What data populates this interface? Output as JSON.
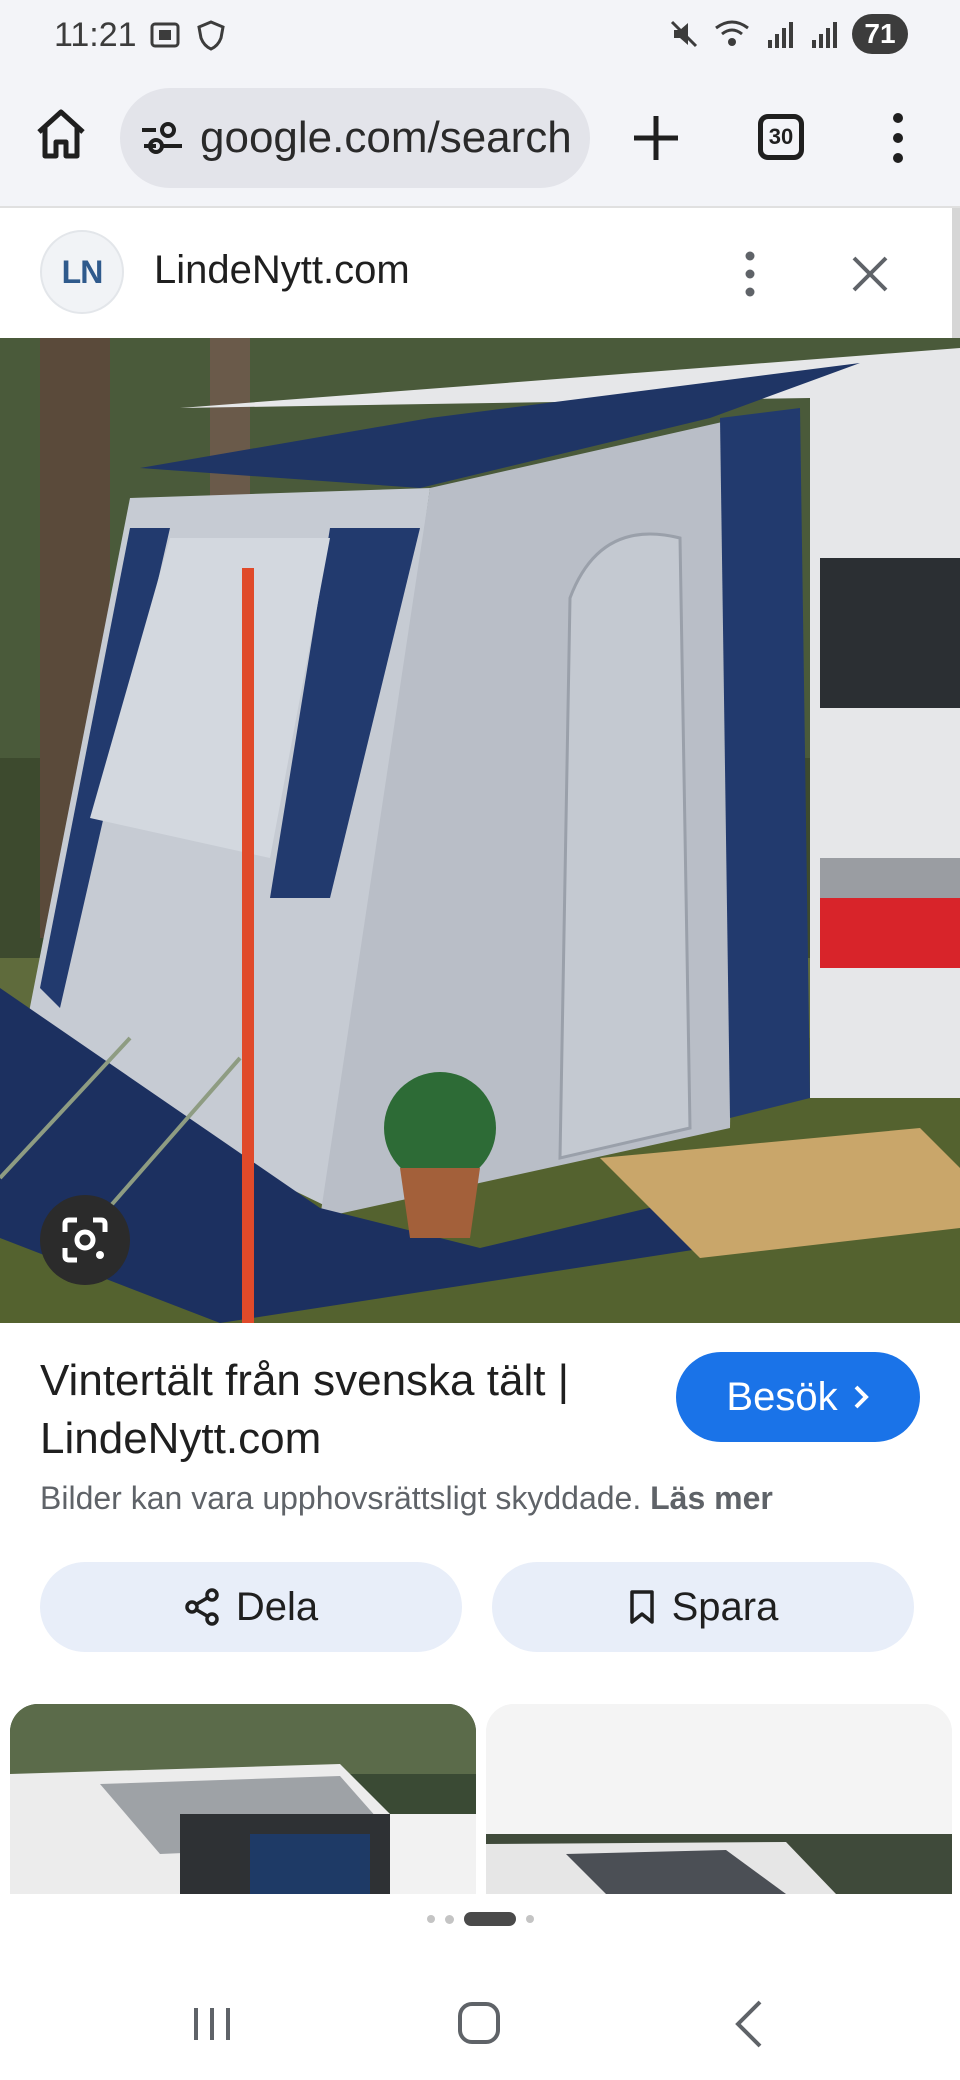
{
  "status_bar": {
    "time": "11:21",
    "battery": "71",
    "icons": [
      "screenshot-icon",
      "shield-icon",
      "mute-icon",
      "wifi-icon",
      "signal-icon",
      "signal-icon"
    ]
  },
  "browser": {
    "url": "google.com/search",
    "tab_count": "30"
  },
  "source": {
    "logo_text": "LN",
    "name": "LindeNytt.com"
  },
  "result": {
    "title": "Vintertält från svenska tält | LindeNytt.com",
    "visit_label": "Besök",
    "copyright_text": "Bilder kan vara upphovsrättsligt skyddade.",
    "learn_more": "Läs mer",
    "share_label": "Dela",
    "save_label": "Spara"
  },
  "colors": {
    "accent": "#1a73e8",
    "chip": "#e8eef9",
    "toolbar": "#f3f4f8"
  }
}
